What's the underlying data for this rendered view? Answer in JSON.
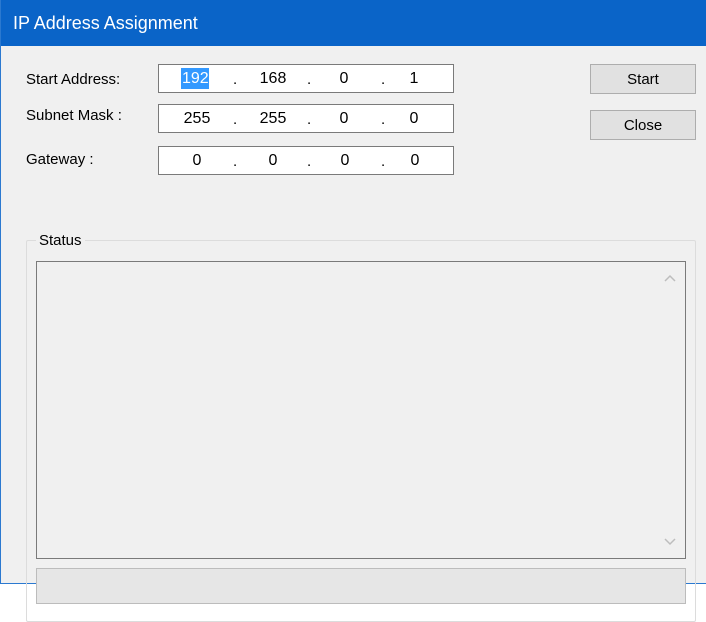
{
  "window": {
    "title": "IP Address Assignment"
  },
  "form": {
    "start_address": {
      "label": "Start Address:",
      "octets": [
        "192",
        "168",
        "0",
        "1"
      ],
      "selected_octet": 0
    },
    "subnet_mask": {
      "label": "Subnet Mask :",
      "octets": [
        "255",
        "255",
        "0",
        "0"
      ]
    },
    "gateway": {
      "label": "Gateway :",
      "octets": [
        "0",
        "0",
        "0",
        "0"
      ]
    },
    "separator": "."
  },
  "buttons": {
    "start": "Start",
    "close": "Close"
  },
  "status": {
    "label": "Status",
    "text": ""
  },
  "progress": {
    "value": 0
  },
  "icons": {
    "scroll_up": "chevron-up-icon",
    "scroll_down": "chevron-down-icon"
  },
  "colors": {
    "titlebar": "#0a64c8",
    "selection": "#3399ff"
  }
}
